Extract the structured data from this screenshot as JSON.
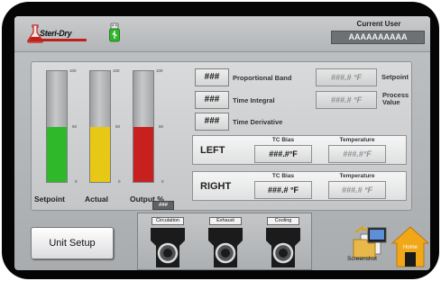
{
  "header": {
    "logo_text": "Steri-Dry",
    "current_user_label": "Current User",
    "current_user_value": "AAAAAAAAAA"
  },
  "bars": {
    "scale_max": "100",
    "scale_mid": "50",
    "scale_min": "0",
    "items": [
      {
        "label": "Setpoint",
        "fill_pct": 50,
        "color": "#2fb82a"
      },
      {
        "label": "Actual",
        "fill_pct": 50,
        "color": "#e6c815"
      },
      {
        "label": "Output %",
        "fill_pct": 50,
        "color": "#c81f1f"
      }
    ],
    "output_value": "###"
  },
  "pid": [
    {
      "value": "###",
      "label": "Proportional Band"
    },
    {
      "value": "###",
      "label": "Time Integral"
    },
    {
      "value": "###",
      "label": "Time Derivative"
    }
  ],
  "setpoint": {
    "value": "###.# °F",
    "label": "Setpoint"
  },
  "process_value": {
    "value": "###.# °F",
    "label_line1": "Process",
    "label_line2": "Value"
  },
  "tc": {
    "bias_header": "TC Bias",
    "temp_header": "Temperature",
    "left": {
      "name": "LEFT",
      "bias": "###.#°F",
      "temp": "###.#°F"
    },
    "right": {
      "name": "RIGHT",
      "bias": "###.# °F",
      "temp": "###.# °F"
    }
  },
  "buttons": {
    "unit_setup": "Unit Setup",
    "screenshot": "Screenshot",
    "home": "Home"
  },
  "pumps": [
    "Circulation",
    "Exhaust",
    "Cooling"
  ]
}
